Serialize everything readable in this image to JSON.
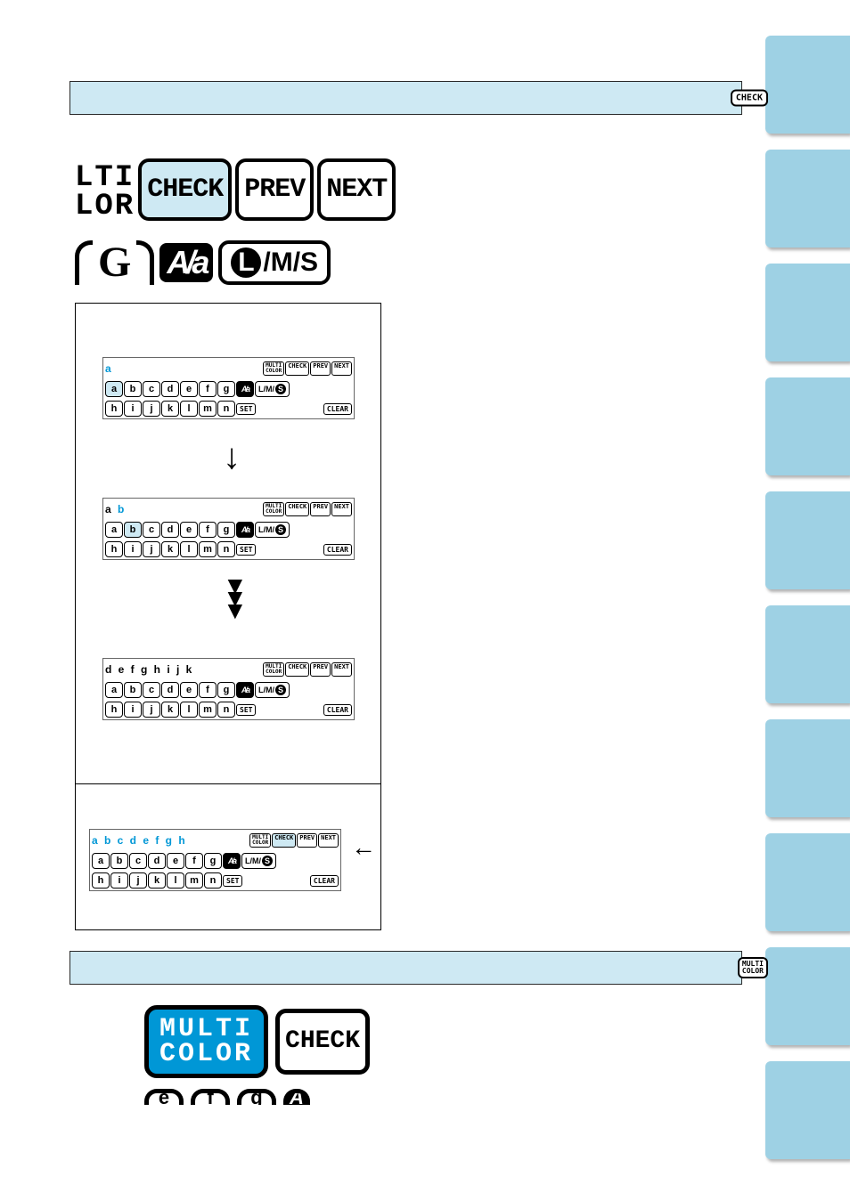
{
  "step7": {
    "badge": "CHECK"
  },
  "step8": {
    "badge_line1": "MULTI",
    "badge_line2": "COLOR"
  },
  "lcd1": {
    "left_line1": "LTI",
    "left_line2": "LOR",
    "btn_check": "CHECK",
    "btn_prev": "PREV",
    "btn_next": "NEXT",
    "big_g": "G",
    "aa_mode": "A/a",
    "lms_L": "L",
    "lms_rest": "/M/S"
  },
  "kb": {
    "multi_line1": "MULTI",
    "multi_line2": "COLOR",
    "check": "CHECK",
    "prev": "PREV",
    "next": "NEXT",
    "set": "SET",
    "clear": "CLEAR",
    "aa": "A/a",
    "lms_prefix": "L/M/",
    "lms_s": "S",
    "row1": [
      "a",
      "b",
      "c",
      "d",
      "e",
      "f",
      "g"
    ],
    "row2": [
      "h",
      "i",
      "j",
      "k",
      "l",
      "m",
      "n"
    ],
    "screen1_text": "a",
    "screen2_prefix": "a ",
    "screen2_blue": "b",
    "screen3_text": "d e f g h i j k",
    "screen4_text": "a b c d e f g h"
  },
  "mc": {
    "line1": "MULTI",
    "line2": "COLOR",
    "check": "CHECK",
    "tab_e": "e",
    "tab_f": "f",
    "tab_g": "g",
    "tab_aa": "A"
  }
}
